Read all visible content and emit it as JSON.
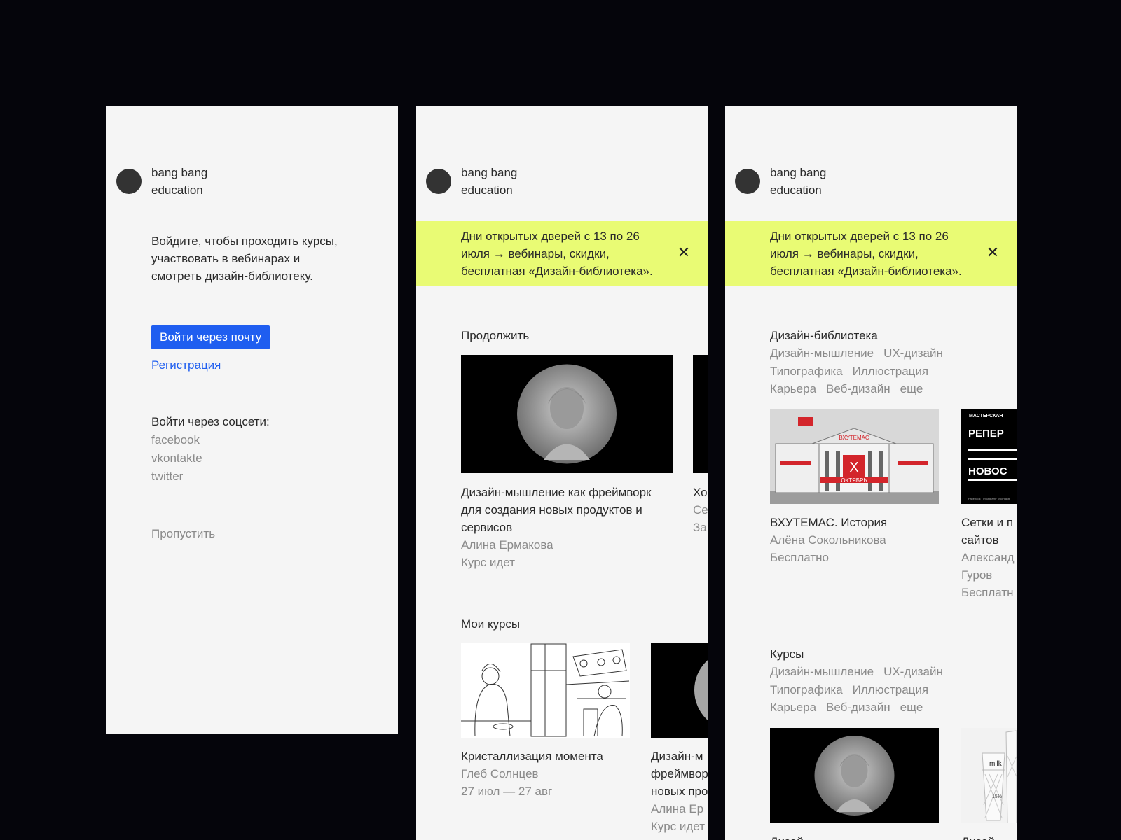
{
  "brand": {
    "line1": "bang bang",
    "line2": "education"
  },
  "login": {
    "intro_line1": "Войдите, чтобы проходить курсы,",
    "intro_line2": "участвовать в вебинарах и",
    "intro_line3": "смотреть дизайн-библиотеку.",
    "email_button": "Войти через почту",
    "register_link": "Регистрация",
    "social_title": "Войти через соцсети:",
    "social": [
      "facebook",
      "vkontakte",
      "twitter"
    ],
    "skip": "Пропустить"
  },
  "banner": {
    "line1": "Дни открытых дверей с 13 по 26",
    "line2": "июля → вебинары, скидки,",
    "line3": "бесплатная «Дизайн-библиотека».",
    "close": "✕"
  },
  "dashboard": {
    "continue_title": "Продолжить",
    "continue_cards": [
      {
        "title_line1": "Дизайн-мышление как фреймворк",
        "title_line2": "для создания новых продуктов и",
        "title_line3": "сервисов",
        "author": "Алина Ермакова",
        "status": "Курс идет"
      },
      {
        "title_partial": "Хо",
        "sub1": "Се",
        "sub2": "За"
      }
    ],
    "my_courses_title": "Мои курсы",
    "my_courses": [
      {
        "title": "Кристаллизация момента",
        "author": "Глеб Солнцев",
        "dates": "27 июл — 27 авг"
      },
      {
        "title_line1": "Дизайн-м",
        "title_line2": "фреймвор",
        "title_line3": "новых про",
        "author": "Алина Ер",
        "status": "Курс идет"
      }
    ]
  },
  "library": {
    "title": "Дизайн-библиотека",
    "tags": [
      "Дизайн-мышление",
      "UX-дизайн",
      "Типографика",
      "Иллюстрация",
      "Карьера",
      "Веб-дизайн",
      "еще"
    ],
    "cards": [
      {
        "title": "ВХУТЕМАС. История",
        "author": "Алёна Сокольникова",
        "price": "Бесплатно",
        "poster_top": "ВХУТЕМАС",
        "poster_mid": "X",
        "poster_bottom": "ОКТЯБРЬ"
      },
      {
        "title_line1": "Сетки и п",
        "title_line2": "сайтов",
        "author_line1": "Александ",
        "author_line2": "Гуров",
        "price": "Бесплатн",
        "poster_label": "МАСТЕРСКАЯ",
        "poster_word1": "РЕПЕР",
        "poster_word2": "НОВОС",
        "poster_foot": "Facebook · Instagram · Vkontakte"
      }
    ],
    "courses_title": "Курсы",
    "course_tags": [
      "Дизайн-мышление",
      "UX-дизайн",
      "Типографика",
      "Иллюстрация",
      "Карьера",
      "Веб-дизайн",
      "еще"
    ],
    "course_cards": [
      {
        "title": "Дизай"
      },
      {
        "title": "Дизай",
        "pack_label": "milk",
        "pack_fat": "15%"
      }
    ]
  },
  "colors": {
    "accent": "#1f5ef0",
    "banner": "#e9fb74",
    "background": "#05050b",
    "screen": "#f5f5f5"
  }
}
